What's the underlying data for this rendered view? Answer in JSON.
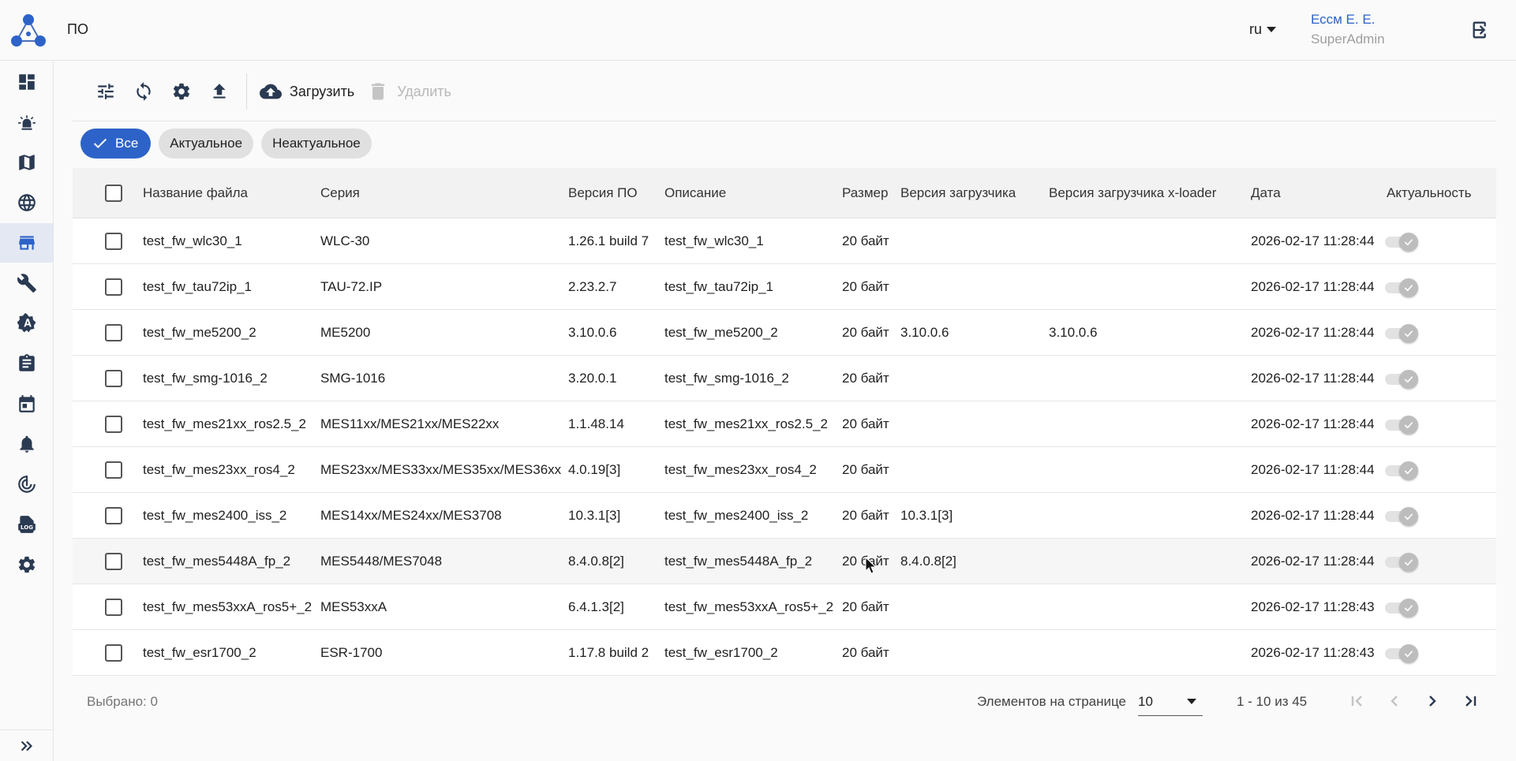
{
  "header": {
    "page_title": "ПО",
    "language": "ru",
    "user_name": "Ессм Е. Е.",
    "user_role": "SuperAdmin"
  },
  "sidebar": {
    "items": [
      {
        "name": "dashboard-icon"
      },
      {
        "name": "alarm-icon"
      },
      {
        "name": "map-icon"
      },
      {
        "name": "globe-icon"
      },
      {
        "name": "store-icon",
        "active": true
      },
      {
        "name": "wrench-icon"
      },
      {
        "name": "admin-badge-icon"
      },
      {
        "name": "clipboard-icon"
      },
      {
        "name": "calendar-icon"
      },
      {
        "name": "bell-icon"
      },
      {
        "name": "radar-icon"
      },
      {
        "name": "log-icon"
      },
      {
        "name": "settings-icon"
      }
    ]
  },
  "toolbar": {
    "upload_label": "Загрузить",
    "delete_label": "Удалить"
  },
  "filters": {
    "all": "Все",
    "actual": "Актуальное",
    "not_actual": "Неактуальное"
  },
  "table": {
    "columns": {
      "file_name": "Название файла",
      "series": "Серия",
      "fw_version": "Версия ПО",
      "description": "Описание",
      "size": "Размер",
      "bootloader": "Версия загрузчика",
      "xloader": "Версия загрузчика x-loader",
      "date": "Дата",
      "actuality": "Актуальность"
    },
    "rows": [
      {
        "file_name": "test_fw_wlc30_1",
        "series": "WLC-30",
        "fw_version": "1.26.1 build 7",
        "description": "test_fw_wlc30_1",
        "size": "20 байт",
        "bootloader": "",
        "xloader": "",
        "date": "2026-02-17 11:28:44"
      },
      {
        "file_name": "test_fw_tau72ip_1",
        "series": "TAU-72.IP",
        "fw_version": "2.23.2.7",
        "description": "test_fw_tau72ip_1",
        "size": "20 байт",
        "bootloader": "",
        "xloader": "",
        "date": "2026-02-17 11:28:44"
      },
      {
        "file_name": "test_fw_me5200_2",
        "series": "ME5200",
        "fw_version": "3.10.0.6",
        "description": "test_fw_me5200_2",
        "size": "20 байт",
        "bootloader": "3.10.0.6",
        "xloader": "3.10.0.6",
        "date": "2026-02-17 11:28:44"
      },
      {
        "file_name": "test_fw_smg-1016_2",
        "series": "SMG-1016",
        "fw_version": "3.20.0.1",
        "description": "test_fw_smg-1016_2",
        "size": "20 байт",
        "bootloader": "",
        "xloader": "",
        "date": "2026-02-17 11:28:44"
      },
      {
        "file_name": "test_fw_mes21xx_ros2.5_2",
        "series": "MES11xx/MES21xx/MES22xx",
        "fw_version": "1.1.48.14",
        "description": "test_fw_mes21xx_ros2.5_2",
        "size": "20 байт",
        "bootloader": "",
        "xloader": "",
        "date": "2026-02-17 11:28:44"
      },
      {
        "file_name": "test_fw_mes23xx_ros4_2",
        "series": "MES23xx/MES33xx/MES35xx/MES36xx",
        "fw_version": "4.0.19[3]",
        "description": "test_fw_mes23xx_ros4_2",
        "size": "20 байт",
        "bootloader": "",
        "xloader": "",
        "date": "2026-02-17 11:28:44"
      },
      {
        "file_name": "test_fw_mes2400_iss_2",
        "series": "MES14xx/MES24xx/MES3708",
        "fw_version": "10.3.1[3]",
        "description": "test_fw_mes2400_iss_2",
        "size": "20 байт",
        "bootloader": "10.3.1[3]",
        "xloader": "",
        "date": "2026-02-17 11:28:44"
      },
      {
        "file_name": "test_fw_mes5448A_fp_2",
        "series": "MES5448/MES7048",
        "fw_version": "8.4.0.8[2]",
        "description": "test_fw_mes5448A_fp_2",
        "size": "20 байт",
        "bootloader": "8.4.0.8[2]",
        "xloader": "",
        "date": "2026-02-17 11:28:44"
      },
      {
        "file_name": "test_fw_mes53xxA_ros5+_2",
        "series": "MES53xxA",
        "fw_version": "6.4.1.3[2]",
        "description": "test_fw_mes53xxA_ros5+_2",
        "size": "20 байт",
        "bootloader": "",
        "xloader": "",
        "date": "2026-02-17 11:28:43"
      },
      {
        "file_name": "test_fw_esr1700_2",
        "series": "ESR-1700",
        "fw_version": "1.17.8 build 2",
        "description": "test_fw_esr1700_2",
        "size": "20 байт",
        "bootloader": "",
        "xloader": "",
        "date": "2026-02-17 11:28:43"
      }
    ]
  },
  "footer": {
    "selected_label": "Выбрано: 0",
    "per_page_label": "Элементов на странице",
    "per_page_value": "10",
    "range_label": "1 - 10 из 45"
  },
  "colors": {
    "accent": "#2d63c8",
    "icon": "#2a3a52",
    "active_nav_bg": "#e3e8f3"
  }
}
